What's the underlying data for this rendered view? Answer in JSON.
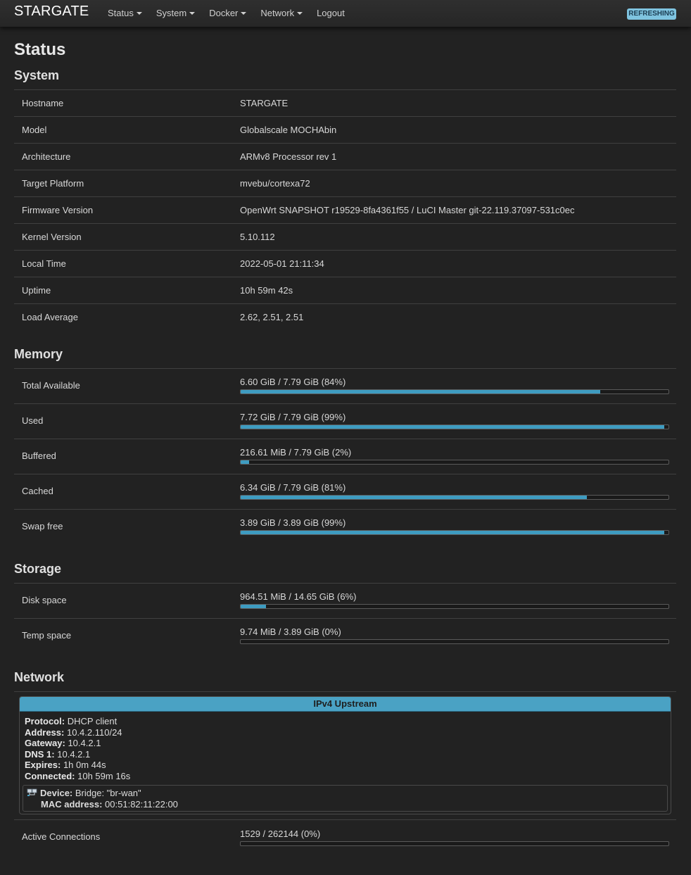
{
  "navbar": {
    "brand": "STARGATE",
    "menu": [
      "Status",
      "System",
      "Docker",
      "Network"
    ],
    "logout": "Logout",
    "badge": "REFRESHING"
  },
  "page_title": "Status",
  "system": {
    "heading": "System",
    "rows": [
      {
        "label": "Hostname",
        "value": "STARGATE"
      },
      {
        "label": "Model",
        "value": "Globalscale MOCHAbin"
      },
      {
        "label": "Architecture",
        "value": "ARMv8 Processor rev 1"
      },
      {
        "label": "Target Platform",
        "value": "mvebu/cortexa72"
      },
      {
        "label": "Firmware Version",
        "value": "OpenWrt SNAPSHOT r19529-8fa4361f55 / LuCI Master git-22.119.37097-531c0ec"
      },
      {
        "label": "Kernel Version",
        "value": "5.10.112"
      },
      {
        "label": "Local Time",
        "value": "2022-05-01 21:11:34"
      },
      {
        "label": "Uptime",
        "value": "10h 59m 42s"
      },
      {
        "label": "Load Average",
        "value": "2.62, 2.51, 2.51"
      }
    ]
  },
  "memory": {
    "heading": "Memory",
    "rows": [
      {
        "label": "Total Available",
        "value": "6.60 GiB / 7.79 GiB (84%)",
        "percent": 84
      },
      {
        "label": "Used",
        "value": "7.72 GiB / 7.79 GiB (99%)",
        "percent": 99
      },
      {
        "label": "Buffered",
        "value": "216.61 MiB / 7.79 GiB (2%)",
        "percent": 2
      },
      {
        "label": "Cached",
        "value": "6.34 GiB / 7.79 GiB (81%)",
        "percent": 81
      },
      {
        "label": "Swap free",
        "value": "3.89 GiB / 3.89 GiB (99%)",
        "percent": 99
      }
    ]
  },
  "storage": {
    "heading": "Storage",
    "rows": [
      {
        "label": "Disk space",
        "value": "964.51 MiB / 14.65 GiB (6%)",
        "percent": 6
      },
      {
        "label": "Temp space",
        "value": "9.74 MiB / 3.89 GiB (0%)",
        "percent": 0
      }
    ]
  },
  "network": {
    "heading": "Network",
    "box_title": "IPv4 Upstream",
    "fields": [
      {
        "key": "Protocol:",
        "value": "DHCP client"
      },
      {
        "key": "Address:",
        "value": "10.4.2.110/24"
      },
      {
        "key": "Gateway:",
        "value": "10.4.2.1"
      },
      {
        "key": "DNS 1:",
        "value": "10.4.2.1"
      },
      {
        "key": "Expires:",
        "value": "1h 0m 44s"
      },
      {
        "key": "Connected:",
        "value": "10h 59m 16s"
      }
    ],
    "device": {
      "key": "Device:",
      "value": "Bridge: \"br-wan\"",
      "mac_key": "MAC address:",
      "mac_value": "00:51:82:11:22:00"
    },
    "connections": {
      "label": "Active Connections",
      "value": "1529 / 262144 (0%)",
      "percent": 0
    }
  }
}
